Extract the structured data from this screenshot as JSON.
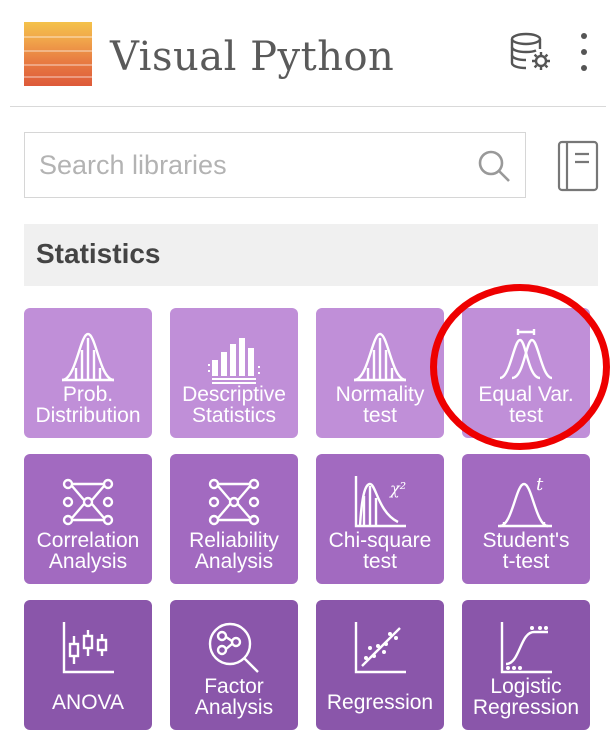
{
  "app": {
    "title": "Visual Python"
  },
  "header": {
    "icons": [
      "database-settings-icon",
      "more-vert-icon"
    ]
  },
  "search": {
    "placeholder": "Search libraries",
    "value": ""
  },
  "category": {
    "title": "Statistics"
  },
  "tiles": [
    {
      "line1": "Prob.",
      "line2": "Distribution",
      "icon": "distribution-icon"
    },
    {
      "line1": "Descriptive",
      "line2": "Statistics",
      "icon": "descriptive-stats-icon"
    },
    {
      "line1": "Normality",
      "line2": "test",
      "icon": "normality-icon"
    },
    {
      "line1": "Equal Var.",
      "line2": "test",
      "icon": "equal-variance-icon"
    },
    {
      "line1": "Correlation",
      "line2": "Analysis",
      "icon": "correlation-icon"
    },
    {
      "line1": "Reliability",
      "line2": "Analysis",
      "icon": "reliability-icon"
    },
    {
      "line1": "Chi-square",
      "line2": "test",
      "icon": "chi-square-icon"
    },
    {
      "line1": "Student's",
      "line2": "t-test",
      "icon": "t-test-icon"
    },
    {
      "line1": "ANOVA",
      "line2": "",
      "icon": "anova-icon"
    },
    {
      "line1": "Factor",
      "line2": "Analysis",
      "icon": "factor-analysis-icon"
    },
    {
      "line1": "Regression",
      "line2": "",
      "icon": "regression-icon"
    },
    {
      "line1": "Logistic",
      "line2": "Regression",
      "icon": "logistic-regression-icon"
    }
  ],
  "colors": {
    "row1": "#c08fd8",
    "row2": "#a26ac0",
    "row3": "#8a56aa",
    "highlight": "#ee0000",
    "logo_top": "#f4c24a",
    "logo_bottom": "#de5a3a"
  }
}
